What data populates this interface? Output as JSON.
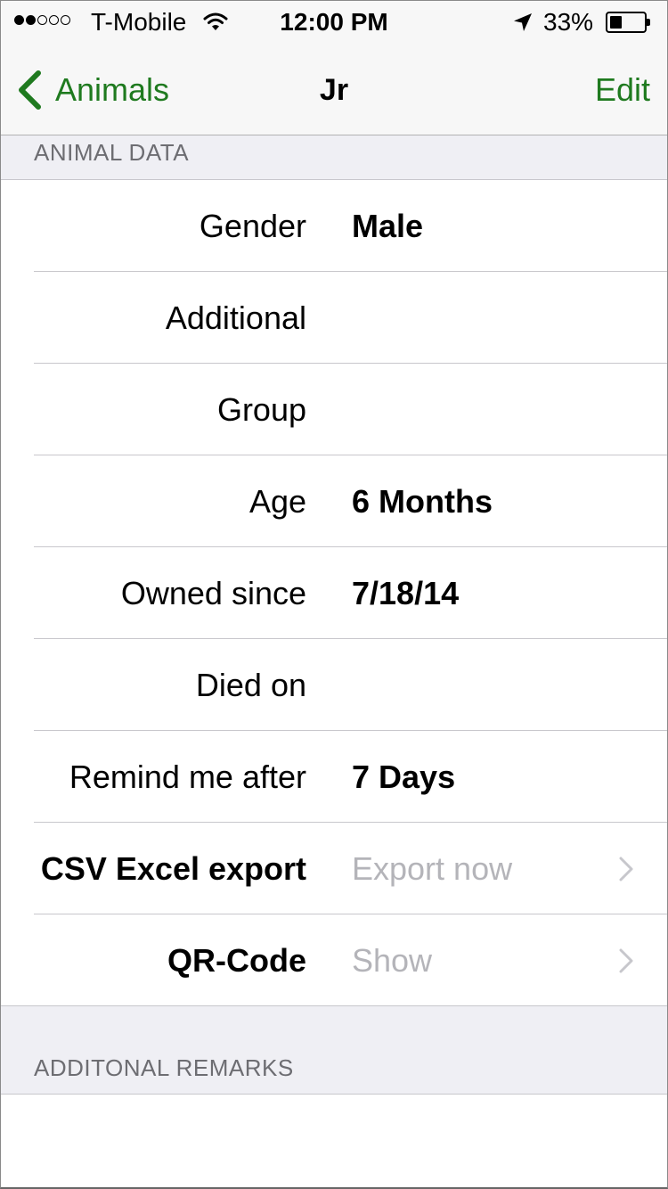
{
  "status_bar": {
    "signal_dots": [
      true,
      true,
      false,
      false,
      false
    ],
    "carrier": "T-Mobile",
    "time": "12:00 PM",
    "battery_percent": "33%",
    "battery_level": 0.33,
    "icons": [
      "wifi-icon",
      "location-arrow-icon",
      "battery-icon"
    ]
  },
  "nav": {
    "back_label": "Animals",
    "title": "Jr",
    "edit_label": "Edit",
    "accent_color": "#1f7a1f",
    "back_icon": "chevron-left-icon"
  },
  "sections": {
    "animal_data": "ANIMAL DATA",
    "remarks": "ADDITONAL REMARKS"
  },
  "rows": [
    {
      "label": "Gender",
      "value": "Male",
      "type": "value"
    },
    {
      "label": "Additional",
      "value": "",
      "type": "value"
    },
    {
      "label": "Group",
      "value": "",
      "type": "value"
    },
    {
      "label": "Age",
      "value": "6 Months",
      "type": "value"
    },
    {
      "label": "Owned since",
      "value": "7/18/14",
      "type": "value"
    },
    {
      "label": "Died on",
      "value": "",
      "type": "value"
    },
    {
      "label": "Remind me after",
      "value": "7 Days",
      "type": "value"
    },
    {
      "label": "CSV Excel export",
      "value": "Export now",
      "type": "action",
      "icon": "chevron-right-icon"
    },
    {
      "label": "QR-Code",
      "value": "Show",
      "type": "action",
      "icon": "chevron-right-icon"
    }
  ],
  "remarks": {
    "text": ""
  }
}
